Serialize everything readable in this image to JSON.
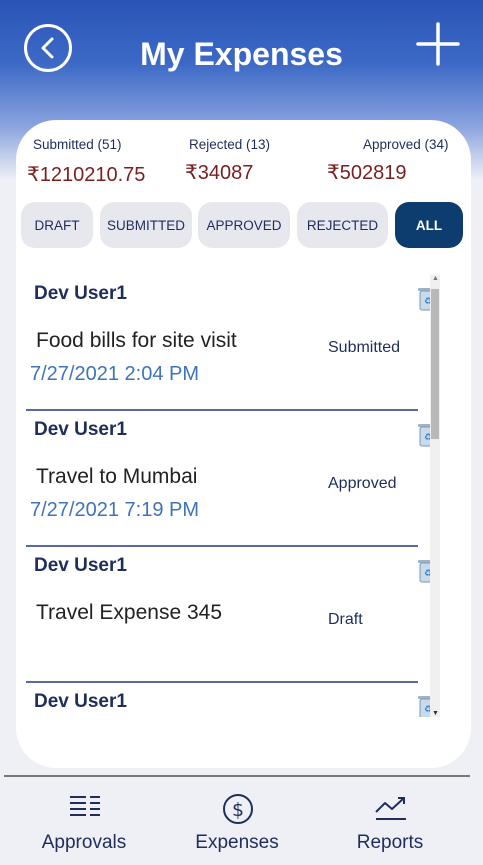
{
  "header": {
    "title": "My Expenses",
    "back_icon": "chevron-left-circle-icon",
    "add_icon": "plus-icon"
  },
  "summary": {
    "submitted_label": "Submitted (51)",
    "submitted_value": "₹1210210.75",
    "rejected_label": "Rejected (13)",
    "rejected_value": "₹34087",
    "approved_label": "Approved (34)",
    "approved_value": "₹502819"
  },
  "filters": [
    {
      "label": "DRAFT",
      "active": false
    },
    {
      "label": "SUBMITTED",
      "active": false
    },
    {
      "label": "APPROVED",
      "active": false
    },
    {
      "label": "REJECTED",
      "active": false
    },
    {
      "label": "ALL",
      "active": true
    }
  ],
  "expenses": [
    {
      "user": "Dev User1",
      "description": "Food bills for site visit",
      "date": "7/27/2021 2:04 PM",
      "status": "Submitted"
    },
    {
      "user": "Dev User1",
      "description": "Travel to Mumbai",
      "date": "7/27/2021 7:19 PM",
      "status": "Approved"
    },
    {
      "user": "Dev User1",
      "description": "Travel Expense 345",
      "date": "",
      "status": "Draft"
    },
    {
      "user": "Dev User1",
      "description": "",
      "date": "",
      "status": ""
    }
  ],
  "bottom_nav": [
    {
      "label": "Approvals",
      "icon": "list-icon"
    },
    {
      "label": "Expenses",
      "icon": "dollar-circle-icon"
    },
    {
      "label": "Reports",
      "icon": "trend-chart-icon"
    }
  ],
  "colors": {
    "header_blue": "#2a55b8",
    "active_chip": "#0d3d6e",
    "amount_red": "#7a1f1f",
    "date_blue": "#3f74b8"
  }
}
